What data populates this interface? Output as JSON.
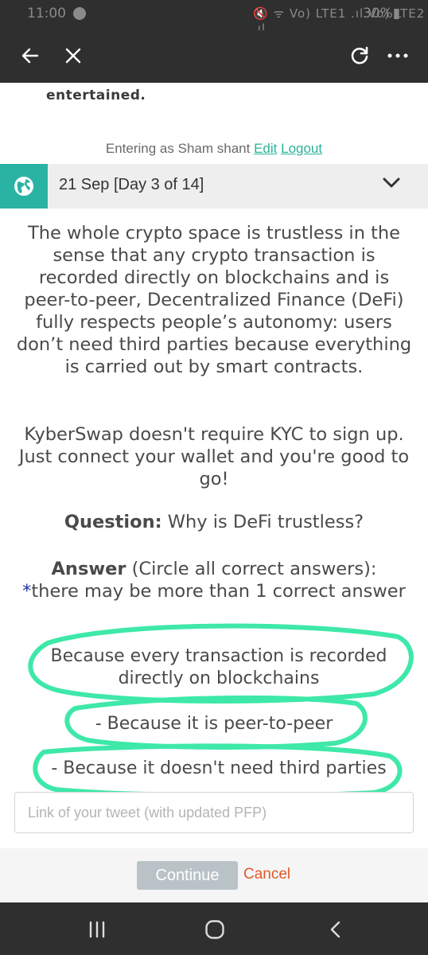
{
  "status_bar": {
    "time": "11:00",
    "sys_icons": "🔇 ᯤ Vo) LTE1 .ıl Vo) LTE2 .ıl",
    "battery": "30%▮"
  },
  "toolbar": {
    "back_icon": "arrow-left-icon",
    "close_icon": "close-icon",
    "refresh_icon": "refresh-icon",
    "more_icon": "more-dots-icon"
  },
  "content": {
    "clipped_text": "entertained.",
    "entering_prefix": "Entering as Sham shant",
    "edit_label": "Edit",
    "logout_label": "Logout",
    "day_label": "21 Sep [Day 3 of 14]",
    "paragraph1": "The whole crypto space is trustless in the sense that any crypto transaction is recorded directly on blockchains and is peer-to-peer, Decentralized Finance (DeFi) fully respects people’s autonomy: users don’t need third parties because everything is carried out by smart contracts.",
    "paragraph2": "KyberSwap doesn't require KYC to sign up. Just connect your wallet and you're good to go!",
    "question_label": "Question:",
    "question_text": " Why is DeFi trustless?",
    "answer_label": "Answer",
    "answer_hint": " (Circle all correct answers):",
    "answer_star": "*",
    "answer_note": "there may be more than 1 correct answer",
    "options": [
      "Because every transaction is recorded directly on blockchains",
      "- Because it is peer-to-peer",
      "- Because it doesn't need third parties"
    ],
    "highlight_color": "#3ee8a8"
  },
  "form": {
    "tweet_placeholder": "Link of your tweet (with updated PFP)",
    "continue_label": "Continue",
    "cancel_label": "Cancel"
  },
  "nav": {
    "recent_icon": "recent-apps-icon",
    "home_icon": "home-icon",
    "back_icon": "nav-back-icon"
  }
}
